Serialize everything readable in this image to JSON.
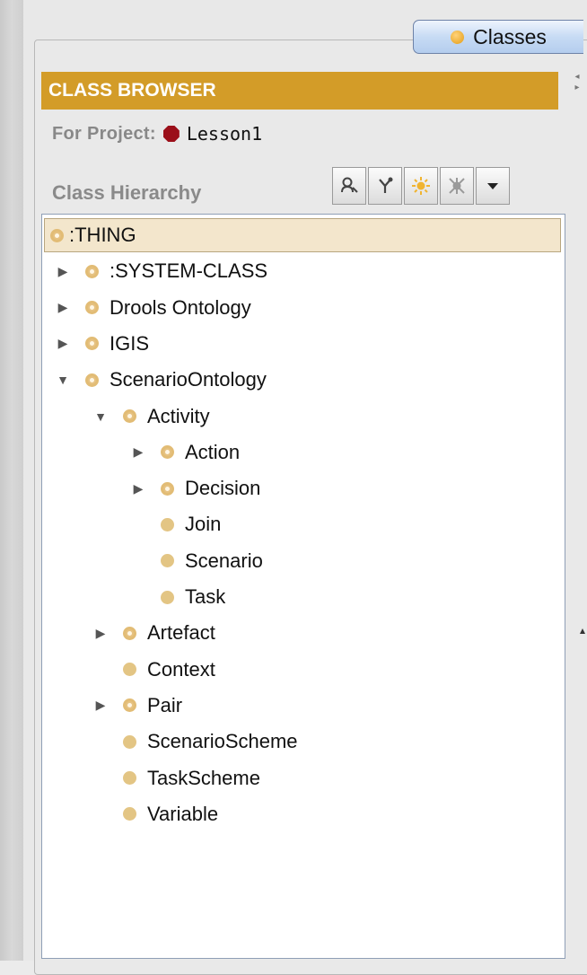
{
  "tab": {
    "label": "Classes",
    "icon": "orange-circle-icon"
  },
  "header": {
    "title": "CLASS BROWSER"
  },
  "project": {
    "label": "For Project:",
    "name": "Lesson1",
    "icon": "red-hexagon-icon"
  },
  "hierarchy": {
    "label": "Class Hierarchy"
  },
  "toolbar": {
    "buttons": [
      {
        "name": "search-user-icon"
      },
      {
        "name": "create-subclass-icon"
      },
      {
        "name": "create-class-sun-icon"
      },
      {
        "name": "delete-class-icon"
      },
      {
        "name": "menu-dropdown-icon"
      }
    ]
  },
  "tree": {
    "items": [
      {
        "label": ":THING",
        "depth": 0,
        "twisty": "none",
        "icon": "ring",
        "selected": true
      },
      {
        "label": ":SYSTEM-CLASS",
        "depth": 0,
        "twisty": "collapsed",
        "icon": "ring"
      },
      {
        "label": "Drools Ontology",
        "depth": 0,
        "twisty": "collapsed",
        "icon": "ring"
      },
      {
        "label": "IGIS",
        "depth": 0,
        "twisty": "collapsed",
        "icon": "ring"
      },
      {
        "label": "ScenarioOntology",
        "depth": 0,
        "twisty": "expanded",
        "icon": "ring"
      },
      {
        "label": "Activity",
        "depth": 1,
        "twisty": "expanded",
        "icon": "ring"
      },
      {
        "label": "Action",
        "depth": 2,
        "twisty": "collapsed",
        "icon": "ring"
      },
      {
        "label": "Decision",
        "depth": 2,
        "twisty": "collapsed",
        "icon": "ring"
      },
      {
        "label": "Join",
        "depth": 2,
        "twisty": "none",
        "icon": "solid"
      },
      {
        "label": "Scenario",
        "depth": 2,
        "twisty": "none",
        "icon": "solid"
      },
      {
        "label": "Task",
        "depth": 2,
        "twisty": "none",
        "icon": "solid"
      },
      {
        "label": "Artefact",
        "depth": 1,
        "twisty": "collapsed",
        "icon": "ring"
      },
      {
        "label": "Context",
        "depth": 1,
        "twisty": "none",
        "icon": "solid"
      },
      {
        "label": "Pair",
        "depth": 1,
        "twisty": "collapsed",
        "icon": "ring"
      },
      {
        "label": "ScenarioScheme",
        "depth": 1,
        "twisty": "none",
        "icon": "solid"
      },
      {
        "label": "TaskScheme",
        "depth": 1,
        "twisty": "none",
        "icon": "solid"
      },
      {
        "label": "Variable",
        "depth": 1,
        "twisty": "none",
        "icon": "solid"
      }
    ]
  },
  "colors": {
    "header_bg": "#d39c28",
    "selection_bg": "#f3e6cc",
    "class_icon": "#e3c584"
  }
}
